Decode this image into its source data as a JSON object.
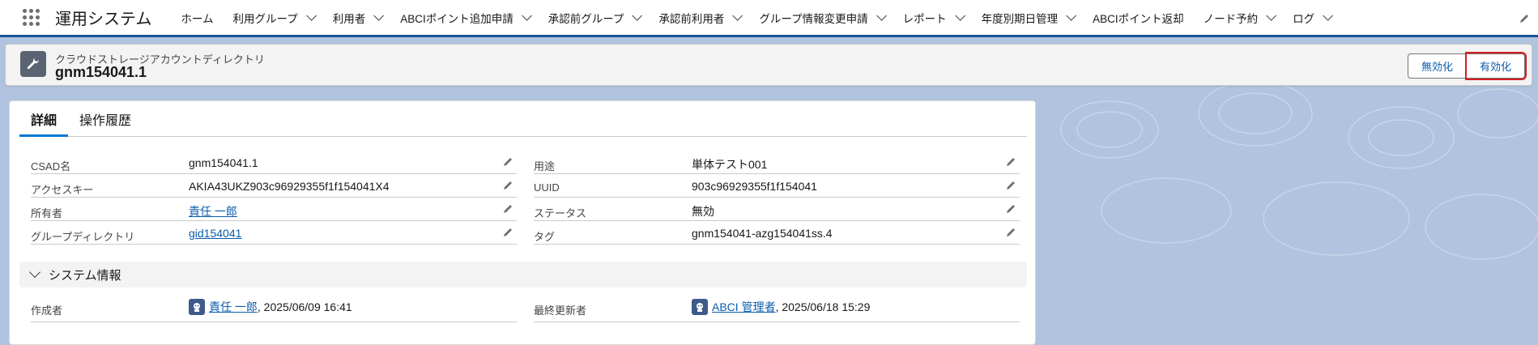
{
  "app": {
    "name": "運用システム"
  },
  "nav": {
    "items": [
      {
        "label": "ホーム",
        "dropdown": false
      },
      {
        "label": "利用グループ",
        "dropdown": true
      },
      {
        "label": "利用者",
        "dropdown": true
      },
      {
        "label": "ABCIポイント追加申請",
        "dropdown": true
      },
      {
        "label": "承認前グループ",
        "dropdown": true
      },
      {
        "label": "承認前利用者",
        "dropdown": true
      },
      {
        "label": "グループ情報変更申請",
        "dropdown": true
      },
      {
        "label": "レポート",
        "dropdown": true
      },
      {
        "label": "年度別期日管理",
        "dropdown": true
      },
      {
        "label": "ABCIポイント返却",
        "dropdown": false
      },
      {
        "label": "ノード予約",
        "dropdown": true
      },
      {
        "label": "ログ",
        "dropdown": true
      }
    ]
  },
  "record": {
    "type": "クラウドストレージアカウントディレクトリ",
    "title": "gnm154041.1",
    "buttons": {
      "deactivate": "無効化",
      "activate": "有効化"
    }
  },
  "tabs": {
    "detail": "詳細",
    "history": "操作履歴"
  },
  "fields": {
    "csad_name": {
      "label": "CSAD名",
      "value": "gnm154041.1"
    },
    "purpose": {
      "label": "用途",
      "value": "単体テスト001"
    },
    "access_key": {
      "label": "アクセスキー",
      "value": "AKIA43UKZ903c96929355f1f154041X4"
    },
    "uuid": {
      "label": "UUID",
      "value": "903c96929355f1f154041"
    },
    "owner": {
      "label": "所有者",
      "value": "責任 一郎"
    },
    "status": {
      "label": "ステータス",
      "value": "無効"
    },
    "group_dir": {
      "label": "グループディレクトリ",
      "value": "gid154041"
    },
    "tag": {
      "label": "タグ",
      "value": "gnm154041-azg154041ss.4"
    }
  },
  "system_info": {
    "title": "システム情報",
    "created_by": {
      "label": "作成者",
      "user": "責任 一郎",
      "date": ", 2025/06/09 16:41"
    },
    "modified_by": {
      "label": "最終更新者",
      "user": "ABCI 管理者",
      "date": ", 2025/06/18 15:29"
    }
  },
  "colors": {
    "accent": "#0176d3",
    "brand": "#1b5297",
    "highlight": "#d81b22"
  }
}
